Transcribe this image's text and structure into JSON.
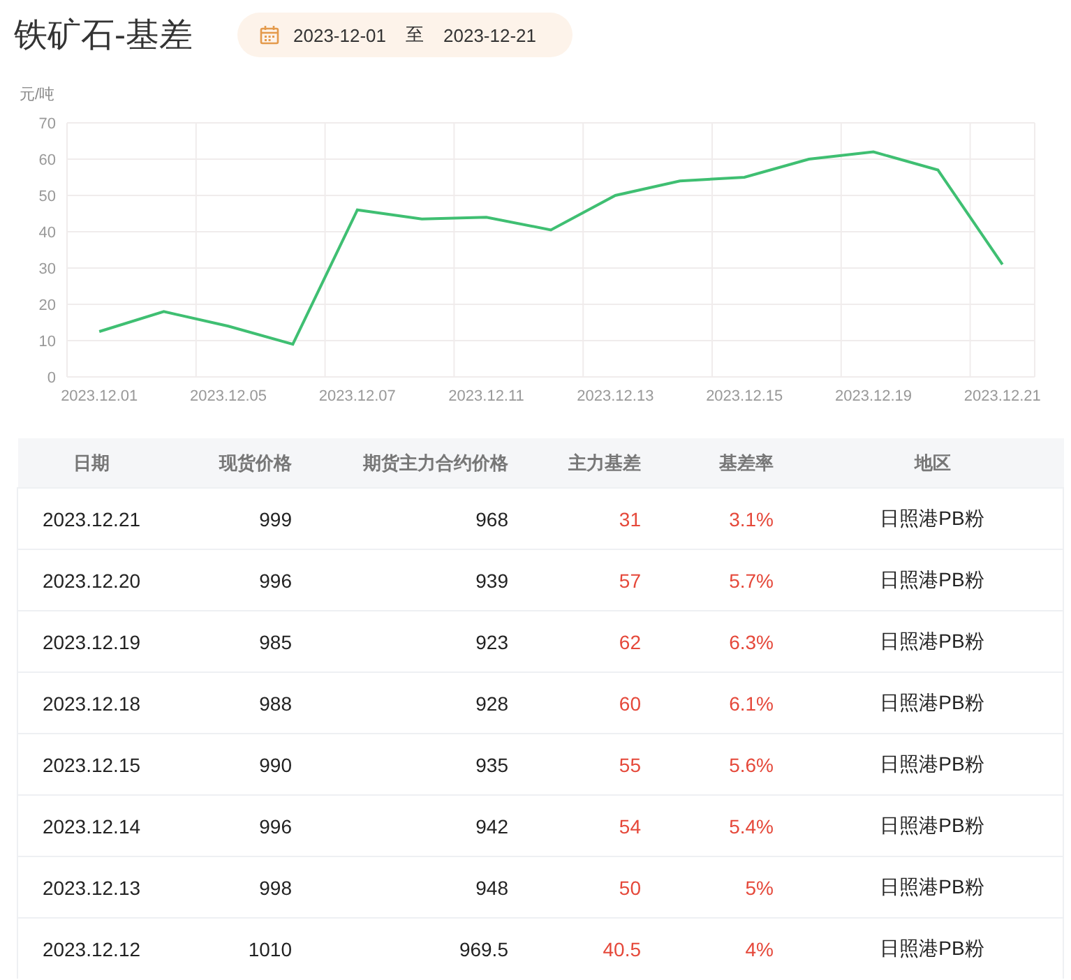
{
  "title": "铁矿石-基差",
  "date_range": {
    "start": "2023-12-01",
    "separator": "至",
    "end": "2023-12-21"
  },
  "chart": {
    "chart_data": {
      "type": "line",
      "ylabel": "元/吨",
      "grid": true,
      "categories": [
        "2023.12.01",
        null,
        "2023.12.05",
        null,
        "2023.12.07",
        null,
        "2023.12.11",
        null,
        "2023.12.13",
        null,
        "2023.12.15",
        null,
        "2023.12.19",
        null,
        "2023.12.21"
      ],
      "series": [
        {
          "color": "#3fbf72",
          "values": [
            12.5,
            18,
            14,
            9,
            46,
            43.5,
            44,
            40.5,
            50,
            54,
            55,
            60,
            62,
            57,
            31
          ]
        }
      ],
      "ylim": [
        0,
        70
      ],
      "yticks": [
        0,
        10,
        20,
        30,
        40,
        50,
        60,
        70
      ]
    }
  },
  "table": {
    "columns": [
      "日期",
      "现货价格",
      "期货主力合约价格",
      "主力基差",
      "基差率",
      "地区"
    ],
    "rows": [
      [
        "2023.12.21",
        "999",
        "968",
        "31",
        "3.1%",
        "日照港PB粉"
      ],
      [
        "2023.12.20",
        "996",
        "939",
        "57",
        "5.7%",
        "日照港PB粉"
      ],
      [
        "2023.12.19",
        "985",
        "923",
        "62",
        "6.3%",
        "日照港PB粉"
      ],
      [
        "2023.12.18",
        "988",
        "928",
        "60",
        "6.1%",
        "日照港PB粉"
      ],
      [
        "2023.12.15",
        "990",
        "935",
        "55",
        "5.6%",
        "日照港PB粉"
      ],
      [
        "2023.12.14",
        "996",
        "942",
        "54",
        "5.4%",
        "日照港PB粉"
      ],
      [
        "2023.12.13",
        "998",
        "948",
        "50",
        "5%",
        "日照港PB粉"
      ],
      [
        "2023.12.12",
        "1010",
        "969.5",
        "40.5",
        "4%",
        "日照港PB粉"
      ]
    ]
  }
}
